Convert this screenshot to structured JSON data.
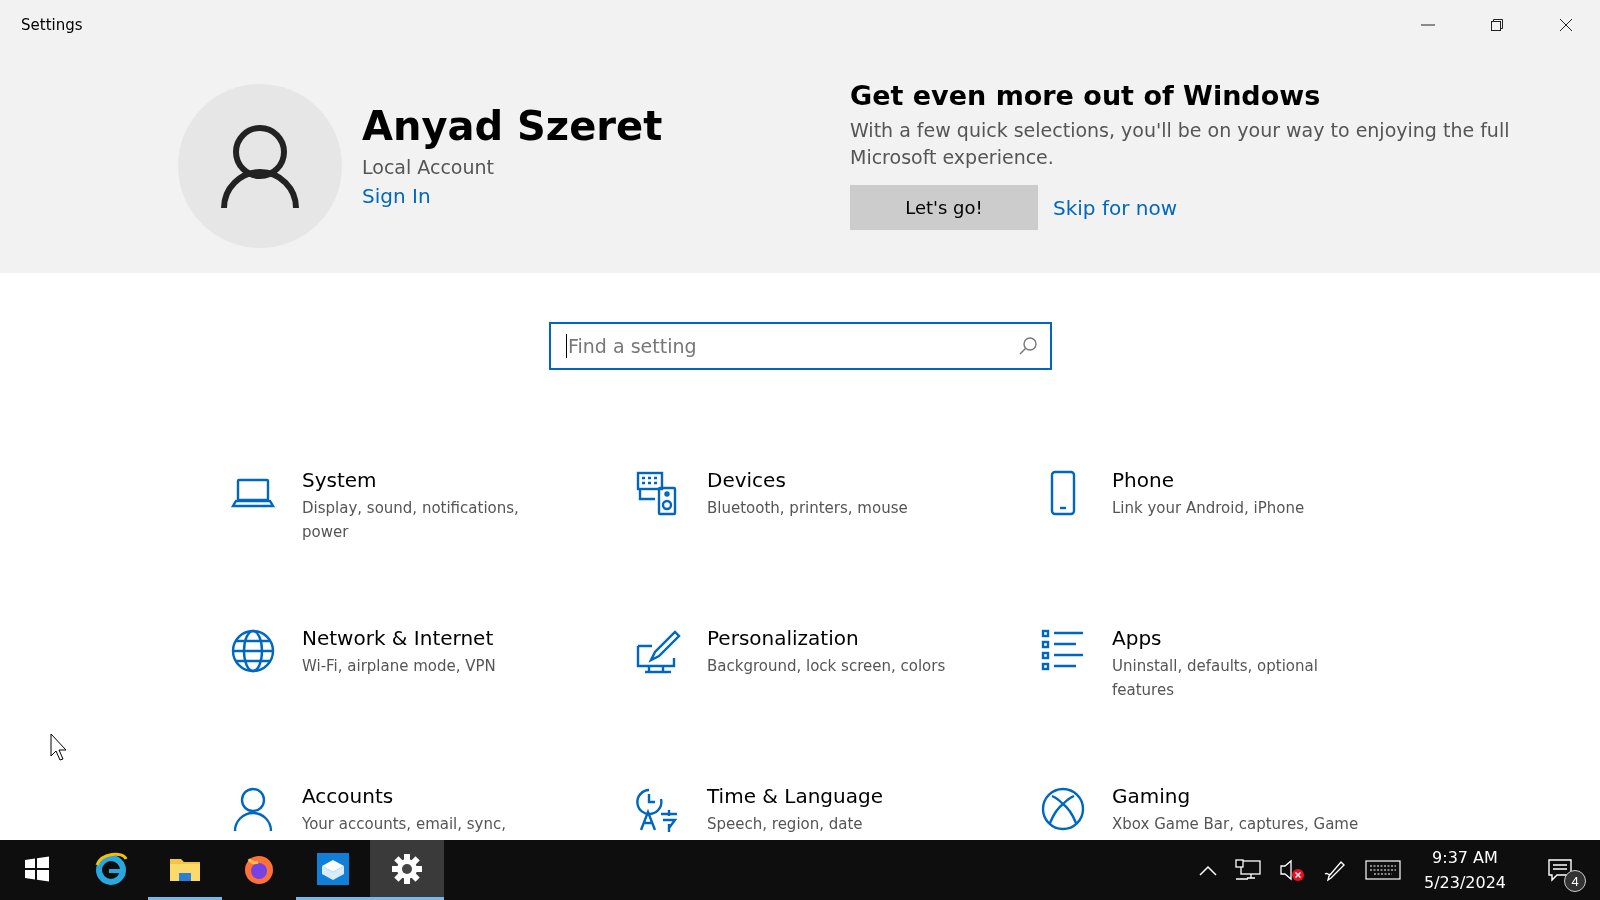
{
  "window": {
    "title": "Settings"
  },
  "account": {
    "name": "Anyad Szeret",
    "type": "Local Account",
    "sign_in": "Sign In"
  },
  "promo": {
    "title": "Get even more out of Windows",
    "text": "With a few quick selections, you'll be on your way to enjoying the full Microsoft experience.",
    "primary": "Let's go!",
    "secondary": "Skip for now"
  },
  "search": {
    "placeholder": "Find a setting"
  },
  "categories": [
    {
      "kind": "laptop",
      "title": "System",
      "desc": "Display, sound, notifications, power"
    },
    {
      "kind": "devices",
      "title": "Devices",
      "desc": "Bluetooth, printers, mouse"
    },
    {
      "kind": "phone",
      "title": "Phone",
      "desc": "Link your Android, iPhone"
    },
    {
      "kind": "globe",
      "title": "Network & Internet",
      "desc": "Wi-Fi, airplane mode, VPN"
    },
    {
      "kind": "brush",
      "title": "Personalization",
      "desc": "Background, lock screen, colors"
    },
    {
      "kind": "list",
      "title": "Apps",
      "desc": "Uninstall, defaults, optional features"
    },
    {
      "kind": "person",
      "title": "Accounts",
      "desc": "Your accounts, email, sync,"
    },
    {
      "kind": "clock",
      "title": "Time & Language",
      "desc": "Speech, region, date"
    },
    {
      "kind": "xbox",
      "title": "Gaming",
      "desc": "Xbox Game Bar, captures, Game"
    }
  ],
  "taskbar": {
    "apps": [
      {
        "kind": "edge",
        "running": false,
        "selected": false
      },
      {
        "kind": "folder",
        "running": true,
        "selected": false
      },
      {
        "kind": "firefox",
        "running": false,
        "selected": false
      },
      {
        "kind": "store",
        "running": true,
        "selected": false
      },
      {
        "kind": "gear",
        "running": true,
        "selected": true
      }
    ],
    "time": "9:37 AM",
    "date": "5/23/2024",
    "notifications": "4"
  }
}
